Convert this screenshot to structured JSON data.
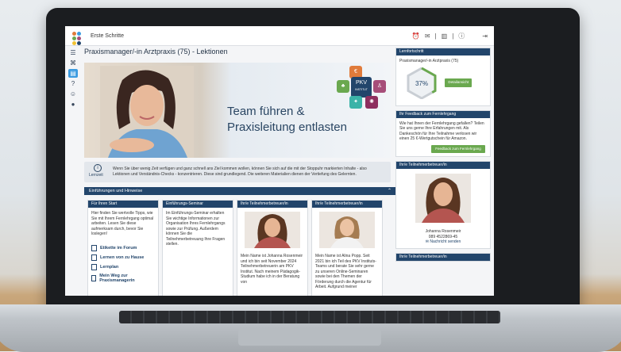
{
  "topbar": {
    "breadcrumb": "Erste Schritte"
  },
  "main": {
    "title": "Praxismanager/-in Arztpraxis (75) - Lektionen"
  },
  "hero": {
    "line1": "Team führen &",
    "line2": "Praxisleitung entlasten",
    "badge": "PKV",
    "badge_sub": "INSTITUT"
  },
  "info": {
    "label": "Lernzeit",
    "text": "Wenn Sie über wenig Zeit verfügen und ganz schnell ans Ziel kommen wollen, können Sie sich auf die mit der Stoppuhr markierten Inhalte - also Lektionen und Verständnis-Checks - konzentrieren. Diese sind grundlegend. Die weiteren Materialien dienen der Vertiefung des Gelernten."
  },
  "section": {
    "title": "Einführungen und Hinweise"
  },
  "cards": [
    {
      "title": "Für Ihren Start",
      "text": "Hier finden Sie wertvolle Tipps, wie Sie mit Ihrem Fernlehrgang optimal arbeiten. Lesen Sie diese aufmerksam durch, bevor Sie loslegen!",
      "links": [
        "Etikette im Forum",
        "Lernen von zu Hause",
        "Lernplan",
        "Mein Weg zur Praxismanagerin"
      ]
    },
    {
      "title": "Einführungs-Seminar",
      "text": "Im Einführungs-Seminar erhalten Sie wichtige Informationen zur Organisation Ihres Fernlehrgangs sowie zur Prüfung. Außerdem können Sie die Teilnehmerbetreuung Ihre Fragen stellen."
    },
    {
      "title": "Ihr/e Teilnehmerbetreuer/in",
      "text": "Mein Name ist Johanna Rosenmeir und ich bin seit November 2024 Teilnehmerbetreuerin am PKV Institut. Nach meinem Pädagogik-Studium habe ich in der Beratung von"
    },
    {
      "title": "Ihr/e Teilnehmerbetreuer/in",
      "text": "Mein Name ist Alina Popp. Seit 2021 bin ich Teil des PKV Instituts-Teams und berate Sie sehr gerne zu unseren Online-Seminaren sowie bei den Themen der Förderung durch die Agentur für Arbeit. Aufgrund meiner"
    }
  ],
  "right": {
    "progress": {
      "title": "Lernfortschritt",
      "course": "Praxismanager/-in Arztpraxis (75)",
      "percent": "37%",
      "value": 0.37,
      "button": "Detailansicht"
    },
    "feedback": {
      "title": "Ihr Feedback zum Fernlehrgang",
      "text": "Wie hat Ihnen der Fernlehrgang gefallen? Teilen Sie uns gerne Ihre Erfahrungen mit. Als Dankeschön für Ihre Teilnahme verlosen wir einen 25 €-Wertgutschein für Amazon.",
      "button": "Feedback zum Fernlehrgang"
    },
    "advisor": {
      "title": "Ihr/e Teilnehmerbetreuer/in",
      "name": "Johanna Rosenmeir",
      "phone": "089 4522869-45",
      "message": "Nachricht senden"
    },
    "advisor2": {
      "title": "Ihr/e Teilnehmerbetreuer/in"
    }
  }
}
